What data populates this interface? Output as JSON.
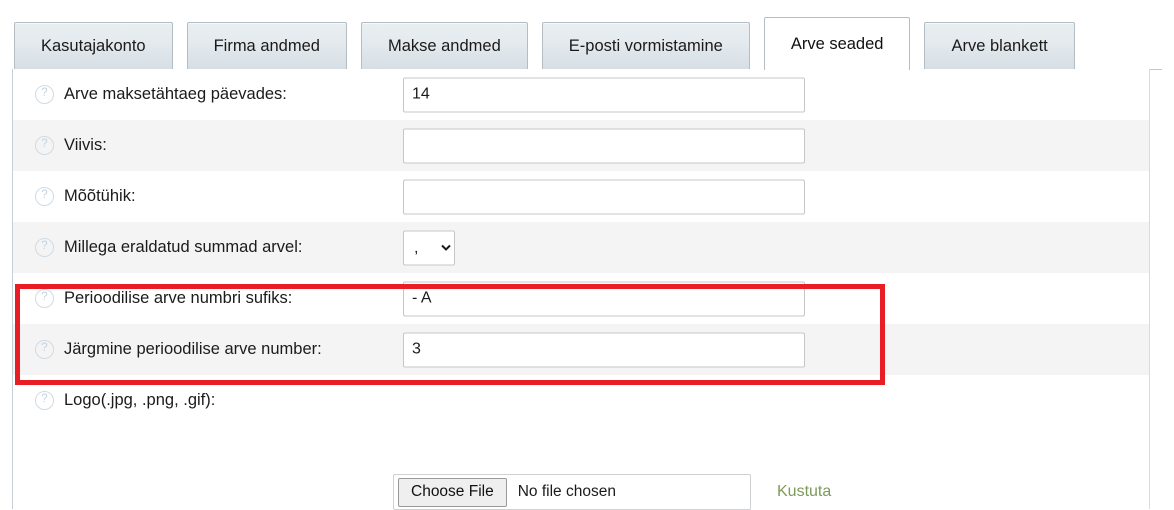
{
  "tabs": [
    {
      "label": "Kasutajakonto",
      "active": false
    },
    {
      "label": "Firma andmed",
      "active": false
    },
    {
      "label": "Makse andmed",
      "active": false
    },
    {
      "label": "E-posti vormistamine",
      "active": false
    },
    {
      "label": "Arve seaded",
      "active": true
    },
    {
      "label": "Arve blankett",
      "active": false
    }
  ],
  "help_icon_glyph": "?",
  "form": {
    "rows": [
      {
        "label": "Arve maksetähtaeg päevades:",
        "control": "text",
        "value": "14",
        "placeholder": "",
        "highlighted": false
      },
      {
        "label": "Viivis:",
        "control": "text",
        "value": "",
        "placeholder": "",
        "highlighted": false
      },
      {
        "label": "Mõõtühik:",
        "control": "text",
        "value": "",
        "placeholder": "",
        "highlighted": false
      },
      {
        "label": "Millega eraldatud summad arvel:",
        "control": "select",
        "value": ",",
        "options": [
          ",",
          "."
        ],
        "highlighted": false
      },
      {
        "label": "Perioodilise arve numbri sufiks:",
        "control": "text",
        "value": "- A",
        "placeholder": "",
        "highlighted": true
      },
      {
        "label": "Järgmine perioodilise arve number:",
        "control": "text",
        "value": "3",
        "placeholder": "",
        "highlighted": true
      },
      {
        "label": "Logo(.jpg, .png, .gif):",
        "control": "none",
        "value": "",
        "highlighted": false
      }
    ]
  },
  "file_upload": {
    "choose_button_label": "Choose File",
    "status_text": "No file chosen",
    "delete_link_label": "Kustuta"
  },
  "colors": {
    "highlight_border": "#e81d26",
    "delete_link": "#7d9b5a",
    "row_alt_background": "#f4f4f4",
    "tab_border": "#b5bdc4"
  }
}
